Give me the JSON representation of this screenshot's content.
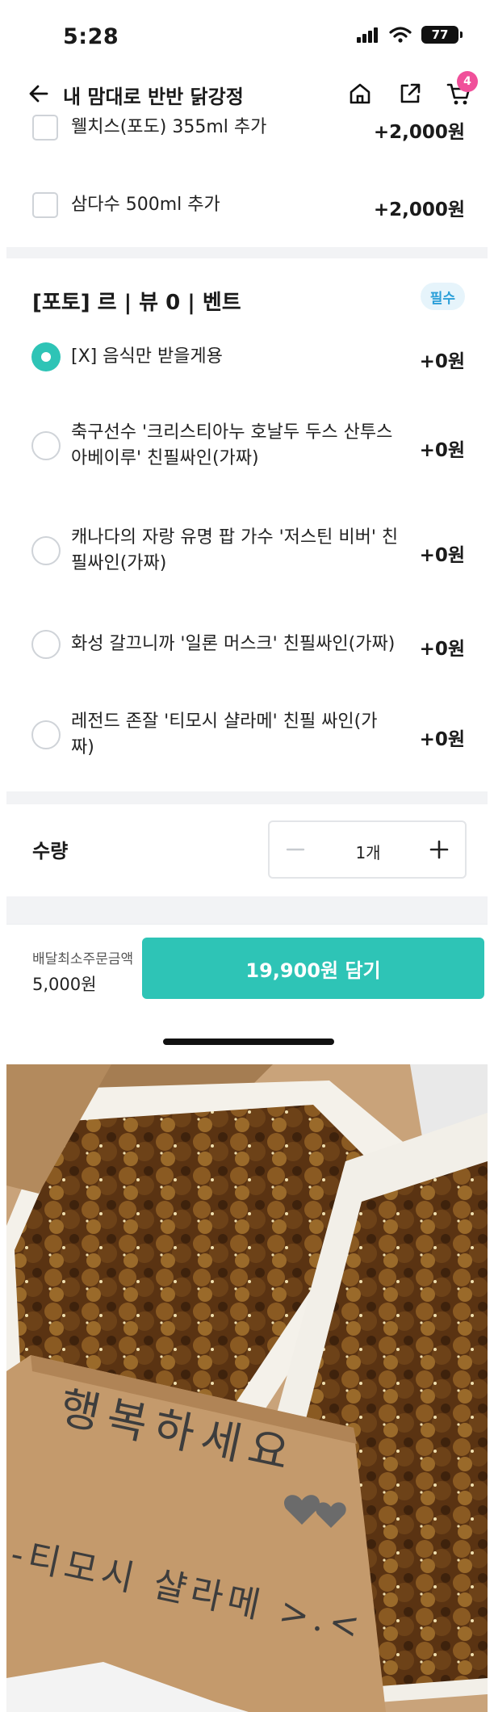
{
  "status_bar": {
    "time": "5:28",
    "battery": "77"
  },
  "header": {
    "title": "내 맘대로 반반 닭강정",
    "cart_count": "4"
  },
  "drinks": [
    {
      "label": "웰치스(포도) 355ml 추가",
      "price": "+2,000원"
    },
    {
      "label": "삼다수 500ml 추가",
      "price": "+2,000원"
    }
  ],
  "event_section": {
    "title": "[포토] 르 | 뷰 0 |  벤트",
    "badge": "필수",
    "options": [
      {
        "line1": "[X] 음식만 받을게용",
        "line2": "",
        "price": "+0원",
        "selected": true
      },
      {
        "line1": "축구선수 '크리스티아누 호날두 두스 산투스",
        "line2": "아베이루' 친필싸인(가짜)",
        "price": "+0원",
        "selected": false
      },
      {
        "line1": "캐나다의 자랑 유명 팝 가수 '저스틴 비버' 친",
        "line2": "필싸인(가짜)",
        "price": "+0원",
        "selected": false
      },
      {
        "line1": "화성 갈끄니까 '일론 머스크' 친필싸인(가짜)",
        "line2": "",
        "price": "+0원",
        "selected": false
      },
      {
        "line1": "레전드 존잘 '티모시 샬라메' 친필 싸인(가",
        "line2": "짜)",
        "price": "+0원",
        "selected": false
      }
    ]
  },
  "quantity": {
    "label": "수량",
    "value": "1개"
  },
  "footer": {
    "min_order_label": "배달최소주문금액",
    "min_order_value": "5,000원",
    "cta_label": "19,900원 담기"
  },
  "photo": {
    "note_line1": "행복하세요",
    "note_line2": "-티모시 샬라메 >.<"
  },
  "colors": {
    "accent": "#2ec4b6",
    "badge_pink": "#f0509a",
    "required_blue": "#2a9fd8"
  }
}
